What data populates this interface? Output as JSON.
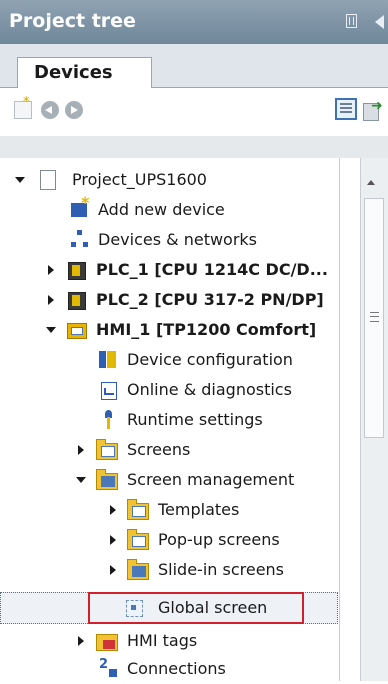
{
  "panel": {
    "title": "Project tree",
    "pin_icon": "pin-icon",
    "collapse_icon": "collapse-left-icon"
  },
  "tab": {
    "label": "Devices"
  },
  "toolbar": {
    "icons": [
      "new-item-icon",
      "back-icon",
      "forward-icon",
      "view-icon",
      "export-icon"
    ]
  },
  "tree": {
    "items": [
      {
        "label": "Project_UPS1600",
        "icon": "project-icon",
        "expand": "expanded",
        "bold": false
      },
      {
        "label": "Add new device",
        "icon": "add-device-icon",
        "expand": "none",
        "bold": false
      },
      {
        "label": "Devices & networks",
        "icon": "network-icon",
        "expand": "none",
        "bold": false
      },
      {
        "label": "PLC_1 [CPU 1214C DC/D...",
        "icon": "plc-icon",
        "expand": "collapsed",
        "bold": true
      },
      {
        "label": "PLC_2 [CPU 317-2 PN/DP]",
        "icon": "plc-icon",
        "expand": "collapsed",
        "bold": true
      },
      {
        "label": "HMI_1 [TP1200 Comfort]",
        "icon": "hmi-icon",
        "expand": "expanded",
        "bold": true
      },
      {
        "label": "Device configuration",
        "icon": "device-config-icon",
        "expand": "none",
        "bold": false
      },
      {
        "label": "Online & diagnostics",
        "icon": "online-diagnostics-icon",
        "expand": "none",
        "bold": false
      },
      {
        "label": "Runtime settings",
        "icon": "runtime-settings-icon",
        "expand": "none",
        "bold": false
      },
      {
        "label": "Screens",
        "icon": "screens-folder-icon",
        "expand": "collapsed",
        "bold": false
      },
      {
        "label": "Screen management",
        "icon": "screen-management-folder-icon",
        "expand": "expanded",
        "bold": false
      },
      {
        "label": "Templates",
        "icon": "templates-folder-icon",
        "expand": "collapsed",
        "bold": false
      },
      {
        "label": "Pop-up screens",
        "icon": "popup-folder-icon",
        "expand": "collapsed",
        "bold": false
      },
      {
        "label": "Slide-in screens",
        "icon": "slidein-folder-icon",
        "expand": "collapsed",
        "bold": false
      },
      {
        "label": "Global screen",
        "icon": "global-screen-icon",
        "expand": "none",
        "bold": false,
        "selected": true
      },
      {
        "label": "HMI tags",
        "icon": "hmi-tags-folder-icon",
        "expand": "collapsed",
        "bold": false
      },
      {
        "label": "Connections",
        "icon": "connections-icon",
        "expand": "none",
        "bold": false
      }
    ]
  },
  "colors": {
    "titlebar": "#7d93a5",
    "selection_outline": "#d0202a",
    "accent_blue": "#2f5fb3",
    "folder_yellow": "#f1c232"
  }
}
